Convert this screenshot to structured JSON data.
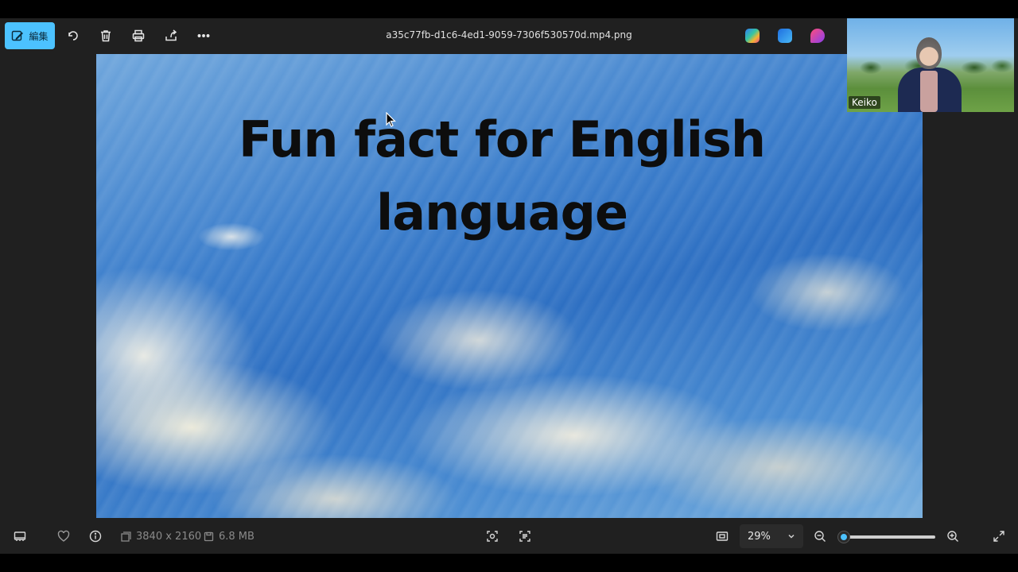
{
  "toolbar": {
    "edit_label": "編集",
    "filename": "a35c77fb-d1c6-4ed1-9059-7306f530570d.mp4.png"
  },
  "slide": {
    "title_line1": "Fun fact for English",
    "title_line2": "language"
  },
  "video": {
    "participant_name": "Keiko"
  },
  "bottombar": {
    "dimensions": "3840 x 2160",
    "file_size": "6.8 MB",
    "zoom_value": "29%",
    "zoom_percent": 29
  },
  "icons": {
    "toolbar": [
      "edit-icon",
      "rotate-icon",
      "delete-icon",
      "print-icon",
      "share-icon",
      "more-icon"
    ],
    "bottombar": [
      "filmstrip-icon",
      "favorite-icon",
      "info-icon",
      "ocr-icon",
      "scan-text-icon",
      "fit-icon",
      "zoom-out-icon",
      "zoom-in-icon",
      "fullscreen-icon"
    ]
  },
  "colors": {
    "accent": "#4cc2ff",
    "app_bg": "#202020"
  }
}
